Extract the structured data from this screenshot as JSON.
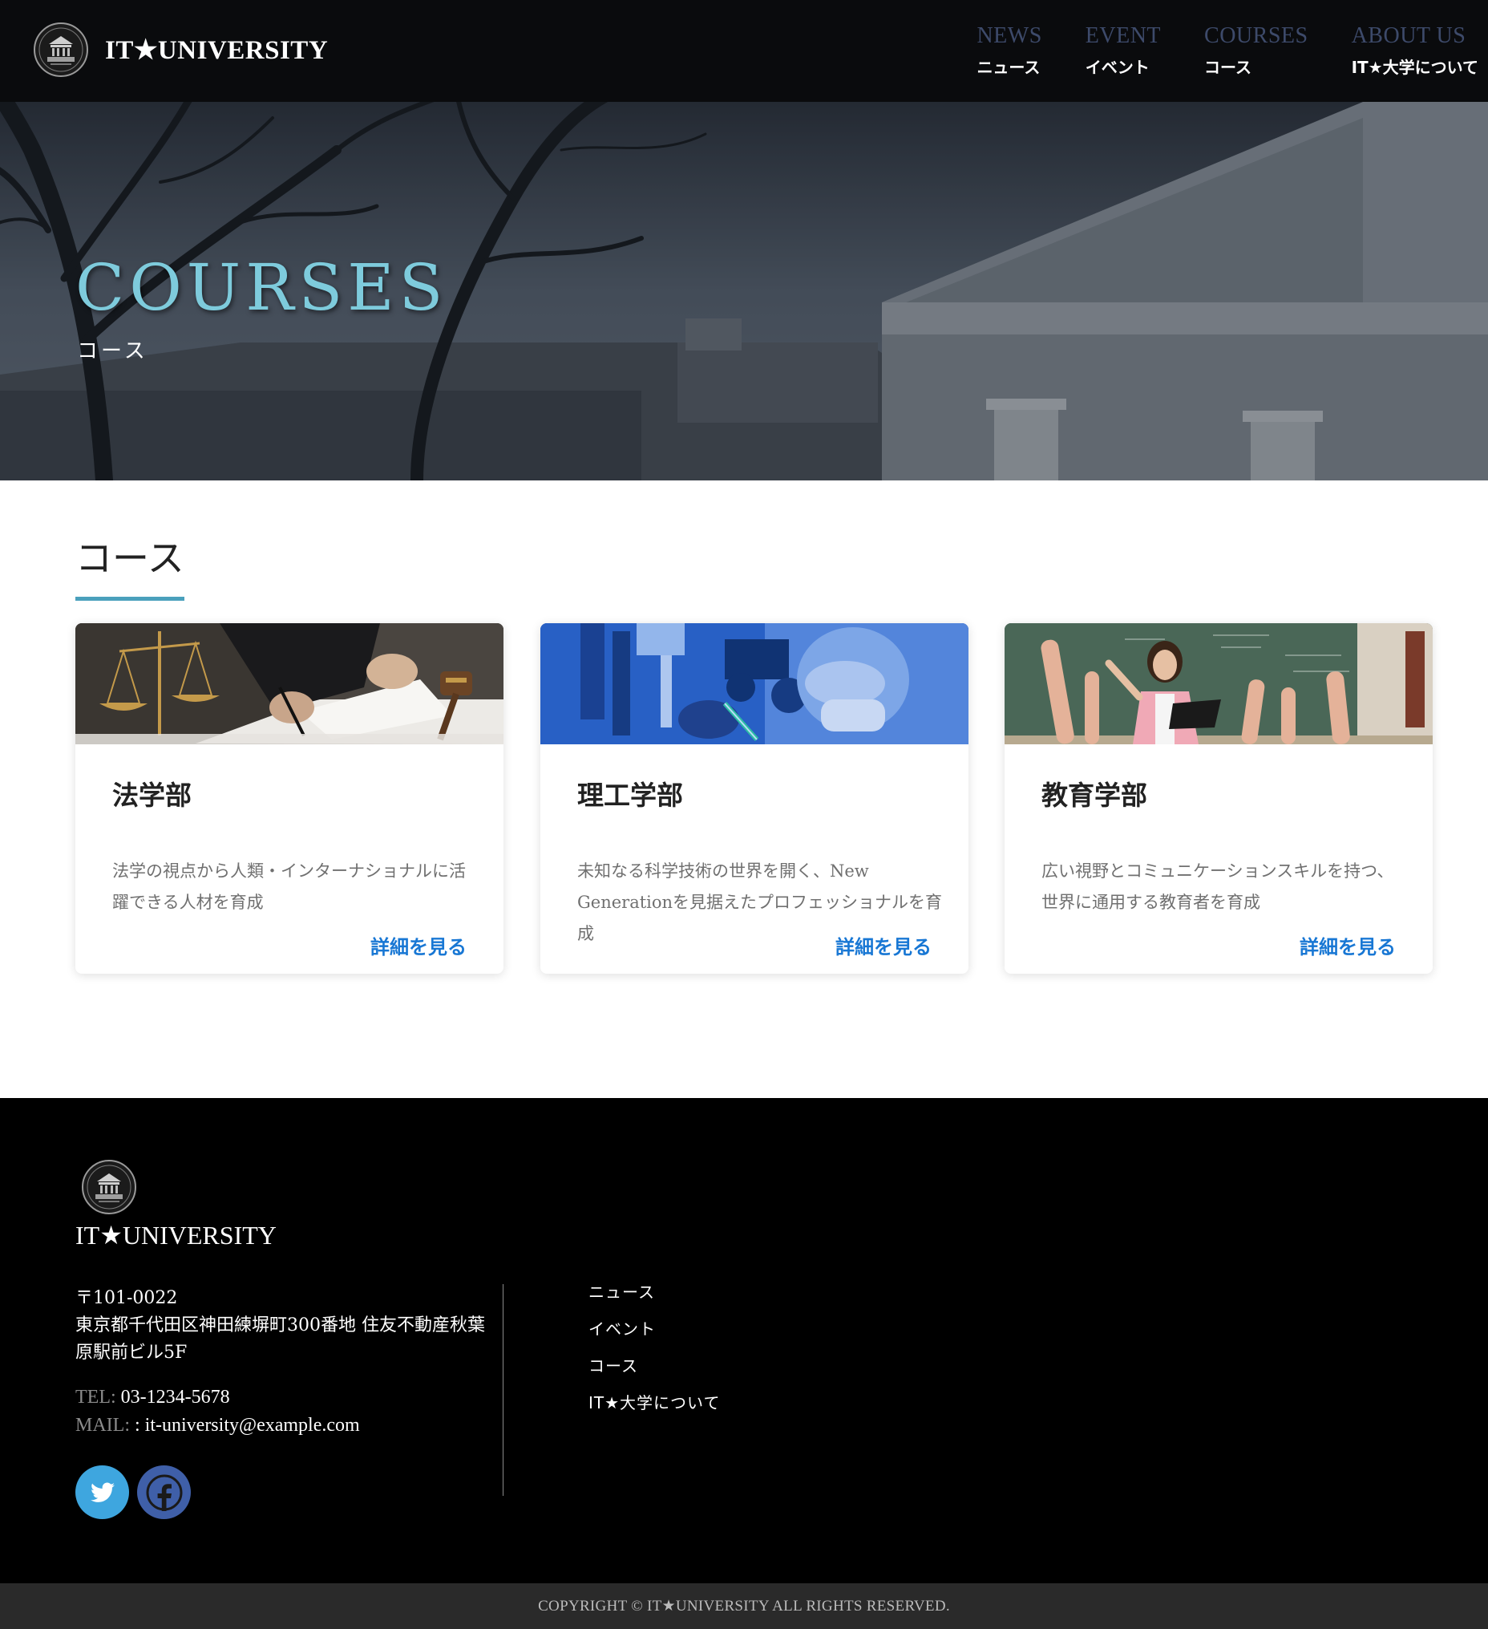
{
  "header": {
    "brand": "IT★UNIVERSITY",
    "nav": [
      {
        "en": "NEWS",
        "jp": "ニュース"
      },
      {
        "en": "EVENT",
        "jp": "イベント"
      },
      {
        "en": "COURSES",
        "jp": "コース"
      },
      {
        "en": "ABOUT US",
        "jp": "IT★大学について"
      }
    ]
  },
  "hero": {
    "title": "COURSES",
    "subtitle": "コース"
  },
  "courses": {
    "heading": "コース",
    "cards": [
      {
        "title": "法学部",
        "description": "法学の視点から人類・インターナショナルに活躍できる人材を育成",
        "link": "詳細を見る",
        "image_icon": "law-scales-gavel-photo"
      },
      {
        "title": "理工学部",
        "description": "未知なる科学技術の世界を開く、New Generationを見据えたプロフェッショナルを育成",
        "link": "詳細を見る",
        "image_icon": "laboratory-scientist-photo"
      },
      {
        "title": "教育学部",
        "description": "広い視野とコミュニケーションスキルを持つ、世界に通用する教育者を育成",
        "link": "詳細を見る",
        "image_icon": "classroom-teacher-photo"
      }
    ]
  },
  "footer": {
    "brand": "IT★UNIVERSITY",
    "postal": "〒101-0022",
    "address": "東京都千代田区神田練塀町300番地 住友不動産秋葉原駅前ビル5F",
    "tel_label": "TEL:",
    "tel": "03-1234-5678",
    "mail_label": "MAIL:",
    "mail": ": it-university@example.com",
    "social": [
      {
        "icon": "twitter-icon",
        "color": "#3ea6df"
      },
      {
        "icon": "facebook-icon",
        "color": "#3f5fa8"
      }
    ],
    "links": [
      "ニュース",
      "イベント",
      "コース",
      "IT★大学について"
    ],
    "copyright": "COPYRIGHT © IT★UNIVERSITY ALL RIGHTS RESERVED."
  },
  "colors": {
    "accent": "#4aa0bc",
    "hero_title": "#7ecbdc",
    "link": "#1877d4",
    "nav_en": "#3d4a6a"
  }
}
